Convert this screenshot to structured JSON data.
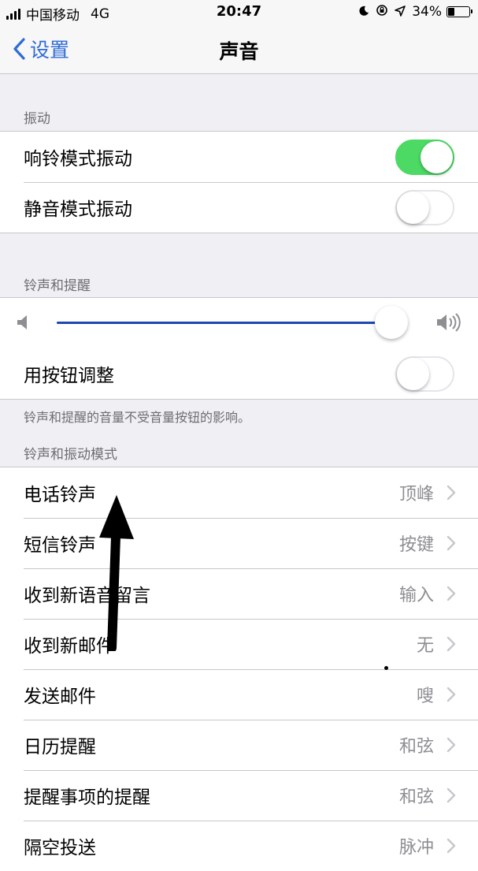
{
  "status_bar": {
    "carrier": "中国移动",
    "network": "4G",
    "time": "20:47",
    "battery_percent": "34%",
    "battery_level": 0.34,
    "icons": [
      "signal-icon",
      "moon-icon",
      "orientation-lock-icon",
      "location-icon",
      "battery-icon"
    ]
  },
  "nav": {
    "back_label": "设置",
    "title": "声音"
  },
  "vibration": {
    "header": "振动",
    "rows": [
      {
        "label": "响铃模式振动",
        "on": true
      },
      {
        "label": "静音模式振动",
        "on": false
      }
    ]
  },
  "ringer": {
    "header": "铃声和提醒",
    "volume_level": 0.96,
    "adjust_label": "用按钮调整",
    "adjust_on": false,
    "footer": "铃声和提醒的音量不受音量按钮的影响。"
  },
  "sounds": {
    "header": "铃声和振动模式",
    "rows": [
      {
        "label": "电话铃声",
        "value": "顶峰"
      },
      {
        "label": "短信铃声",
        "value": "按键"
      },
      {
        "label": "收到新语音留言",
        "value": "输入"
      },
      {
        "label": "收到新邮件",
        "value": "无"
      },
      {
        "label": "发送邮件",
        "value": "嗖"
      },
      {
        "label": "日历提醒",
        "value": "和弦"
      },
      {
        "label": "提醒事项的提醒",
        "value": "和弦"
      },
      {
        "label": "隔空投送",
        "value": "脉冲"
      }
    ]
  },
  "colors": {
    "accent": "#2f6bd9",
    "toggle_on": "#4cd964",
    "slider_fill": "#1e46b4"
  }
}
